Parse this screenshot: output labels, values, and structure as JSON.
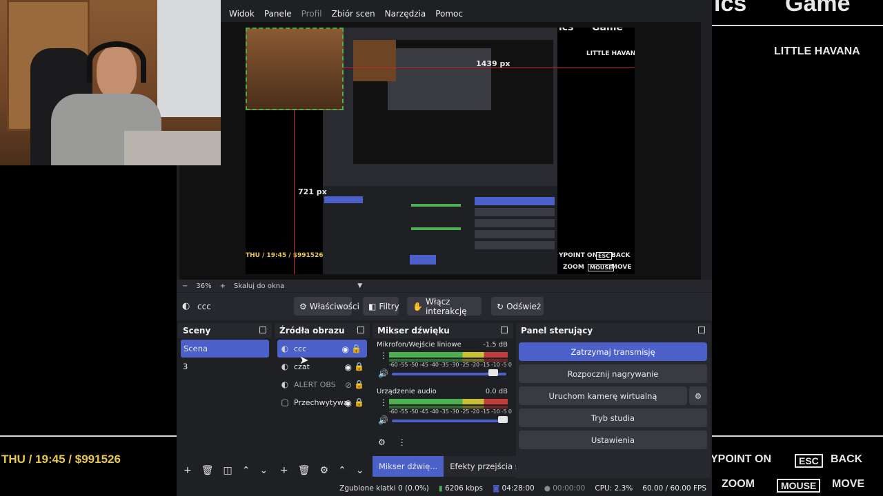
{
  "background": {
    "top_title": "Game",
    "top_fragment": "ics",
    "location": "LITTLE HAVANA",
    "hud_date": "THU / 19:45 / $991526",
    "hud_hint1_action": "YPOINT ON",
    "hud_hint1_key": "ESC",
    "hud_hint1_label": "BACK",
    "hud_hint2_action": "ZOOM",
    "hud_hint2_key": "MOUSE",
    "hud_hint2_label": "MOVE"
  },
  "menubar": {
    "items": [
      "Widok",
      "Panele",
      "Profil",
      "Zbiór scen",
      "Narzędzia",
      "Pomoc"
    ]
  },
  "preview": {
    "width_label": "1439 px",
    "height_label": "721 px",
    "nested_location": "LITTLE HAVANA",
    "nested_date": "THU / 19:45 / $991526",
    "nested_hint1": "YPOINT ON",
    "nested_key1": "ESC",
    "nested_label1": "BACK",
    "nested_hint2": "ZOOM",
    "nested_key2": "MOUSE",
    "nested_label2": "MOVE",
    "nested_title_fragment": "ics",
    "nested_title": "Game"
  },
  "zoombar": {
    "minus": "−",
    "zoom": "36%",
    "plus": "+",
    "mode": "Skaluj do okna",
    "arrow": "▼"
  },
  "context": {
    "source_name": "ccc",
    "properties": "Właściwości",
    "filters": "Filtry",
    "interact": "Włącz interakcję",
    "refresh": "Odśwież"
  },
  "scenes": {
    "title": "Sceny",
    "items": [
      "Scena",
      "3"
    ]
  },
  "sources": {
    "title": "Źródła obrazu",
    "items": [
      "ccc",
      "czat",
      "ALERT OBS",
      "Przechwytywa"
    ]
  },
  "mixer": {
    "title": "Mikser dźwięku",
    "channels": [
      {
        "name": "Mikrofon/Wejście liniowe",
        "db": "-1.5 dB"
      },
      {
        "name": "Urządzenie audio",
        "db": "0.0 dB"
      }
    ],
    "scale": "-60 -55 -50 -45 -40 -35 -30 -25 -20 -15 -10  -5   0"
  },
  "controls": {
    "title": "Panel sterujący",
    "stop_stream": "Zatrzymaj transmisję",
    "start_record": "Rozpocznij nagrywanie",
    "virtual_cam": "Uruchom kamerę wirtualną",
    "studio_mode": "Tryb studia",
    "settings": "Ustawienia"
  },
  "tabs": [
    "Mikser dźwię...",
    "Efekty przejścia sc..."
  ],
  "status": {
    "dropped": "Zgubione klatki 0 (0.0%)",
    "bitrate": "6206 kbps",
    "stream_time": "04:28:00",
    "rec_time": "00:00:00",
    "cpu": "CPU: 2.3%",
    "fps": "60.00 / 60.00 FPS"
  },
  "colors": {
    "accent": "#4b61c9",
    "dock_bg": "#27282d",
    "panel_bg": "#1f2024",
    "hud_yellow": "#e8c84a"
  }
}
